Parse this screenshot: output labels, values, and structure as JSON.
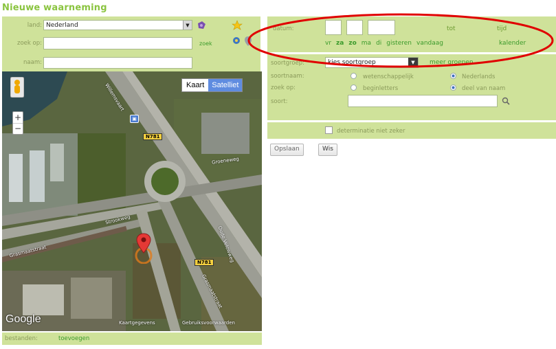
{
  "page_title": "Nieuwe waarneming",
  "left": {
    "land_label": "land:",
    "land_value": "Nederland",
    "zoek_op_label": "zoek op:",
    "zoek_link": "zoek",
    "naam_label": "naam:"
  },
  "map": {
    "toggle_kaart": "Kaart",
    "toggle_satelliet": "Satelliet",
    "road_label_1": "N781",
    "road_label_2": "N781",
    "road_text_1": "Willemsvaart",
    "road_text_2": "Groeneweg",
    "road_text_3": "Grasmaatstraat",
    "road_text_4": "Strookweg",
    "road_text_5": "Oude Velowweg",
    "road_text_6": "Grasmaatstraat",
    "google_logo": "Google",
    "footer_left": "Kaartgegevens",
    "footer_right": "Gebruiksvoorwaarden"
  },
  "bestanden": {
    "label": "bestanden:",
    "link": "toevoegen"
  },
  "date": {
    "datum_label": "datum:",
    "tot_label": "tot",
    "tijd_label": "tijd",
    "days": [
      "vr",
      "za",
      "zo",
      "ma",
      "di"
    ],
    "gisteren": "gisteren",
    "vandaag": "vandaag",
    "kalender": "kalender"
  },
  "species": {
    "soortgroep_label": "soortgroep:",
    "soortgroep_value": "kies soortgroep",
    "meer_groepen": "meer groepen",
    "soortnaam_label": "soortnaam:",
    "wetenschappelijk": "wetenschappelijk",
    "nederlands": "Nederlands",
    "zoek_op_label": "zoek op:",
    "beginletters": "beginletters",
    "deel_van_naam": "deel van naam",
    "soort_label": "soort:",
    "determinatie": "determinatie niet zeker"
  },
  "buttons": {
    "opslaan": "Opslaan",
    "wis": "Wis"
  },
  "colors": {
    "panel_green": "#cfe29a",
    "title_green": "#8ac43f",
    "annotation_red": "#e00000"
  }
}
